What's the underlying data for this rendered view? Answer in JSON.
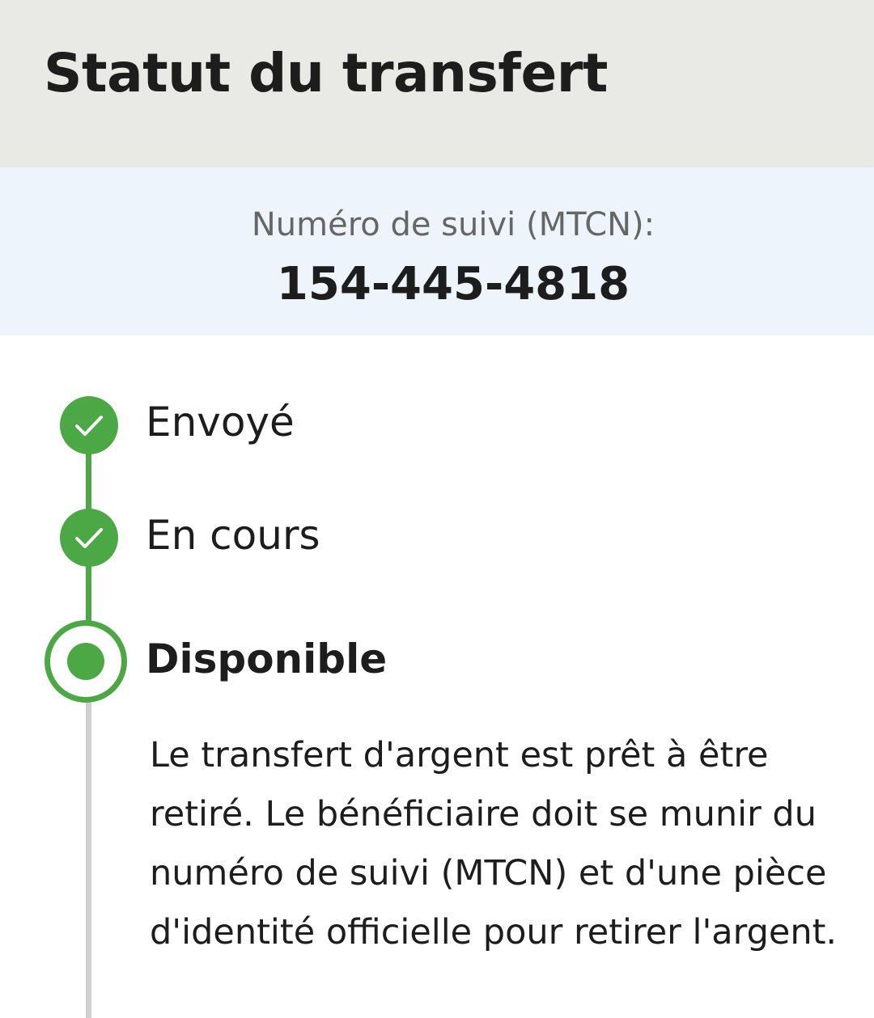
{
  "header": {
    "title": "Statut du transfert"
  },
  "tracking": {
    "label": "Numéro de suivi (MTCN):",
    "number": "154-445-4818"
  },
  "timeline": {
    "steps": [
      {
        "label": "Envoyé",
        "status": "done",
        "icon": "check-circle-icon"
      },
      {
        "label": "En cours",
        "status": "done",
        "icon": "check-circle-icon"
      },
      {
        "label": "Disponible",
        "status": "current",
        "icon": "radio-current-icon"
      }
    ],
    "current_description": "Le transfert d'argent est prêt à être retiré. Le bénéficiaire doit se munir du numéro de suivi (MTCN) et d'une pièce d'identité officielle pour retirer l'argent."
  },
  "colors": {
    "header_bg": "#e9e9e6",
    "tracking_bg": "#edf4fb",
    "accent_green": "#4ca845",
    "pending_line": "#cfcfcf"
  }
}
